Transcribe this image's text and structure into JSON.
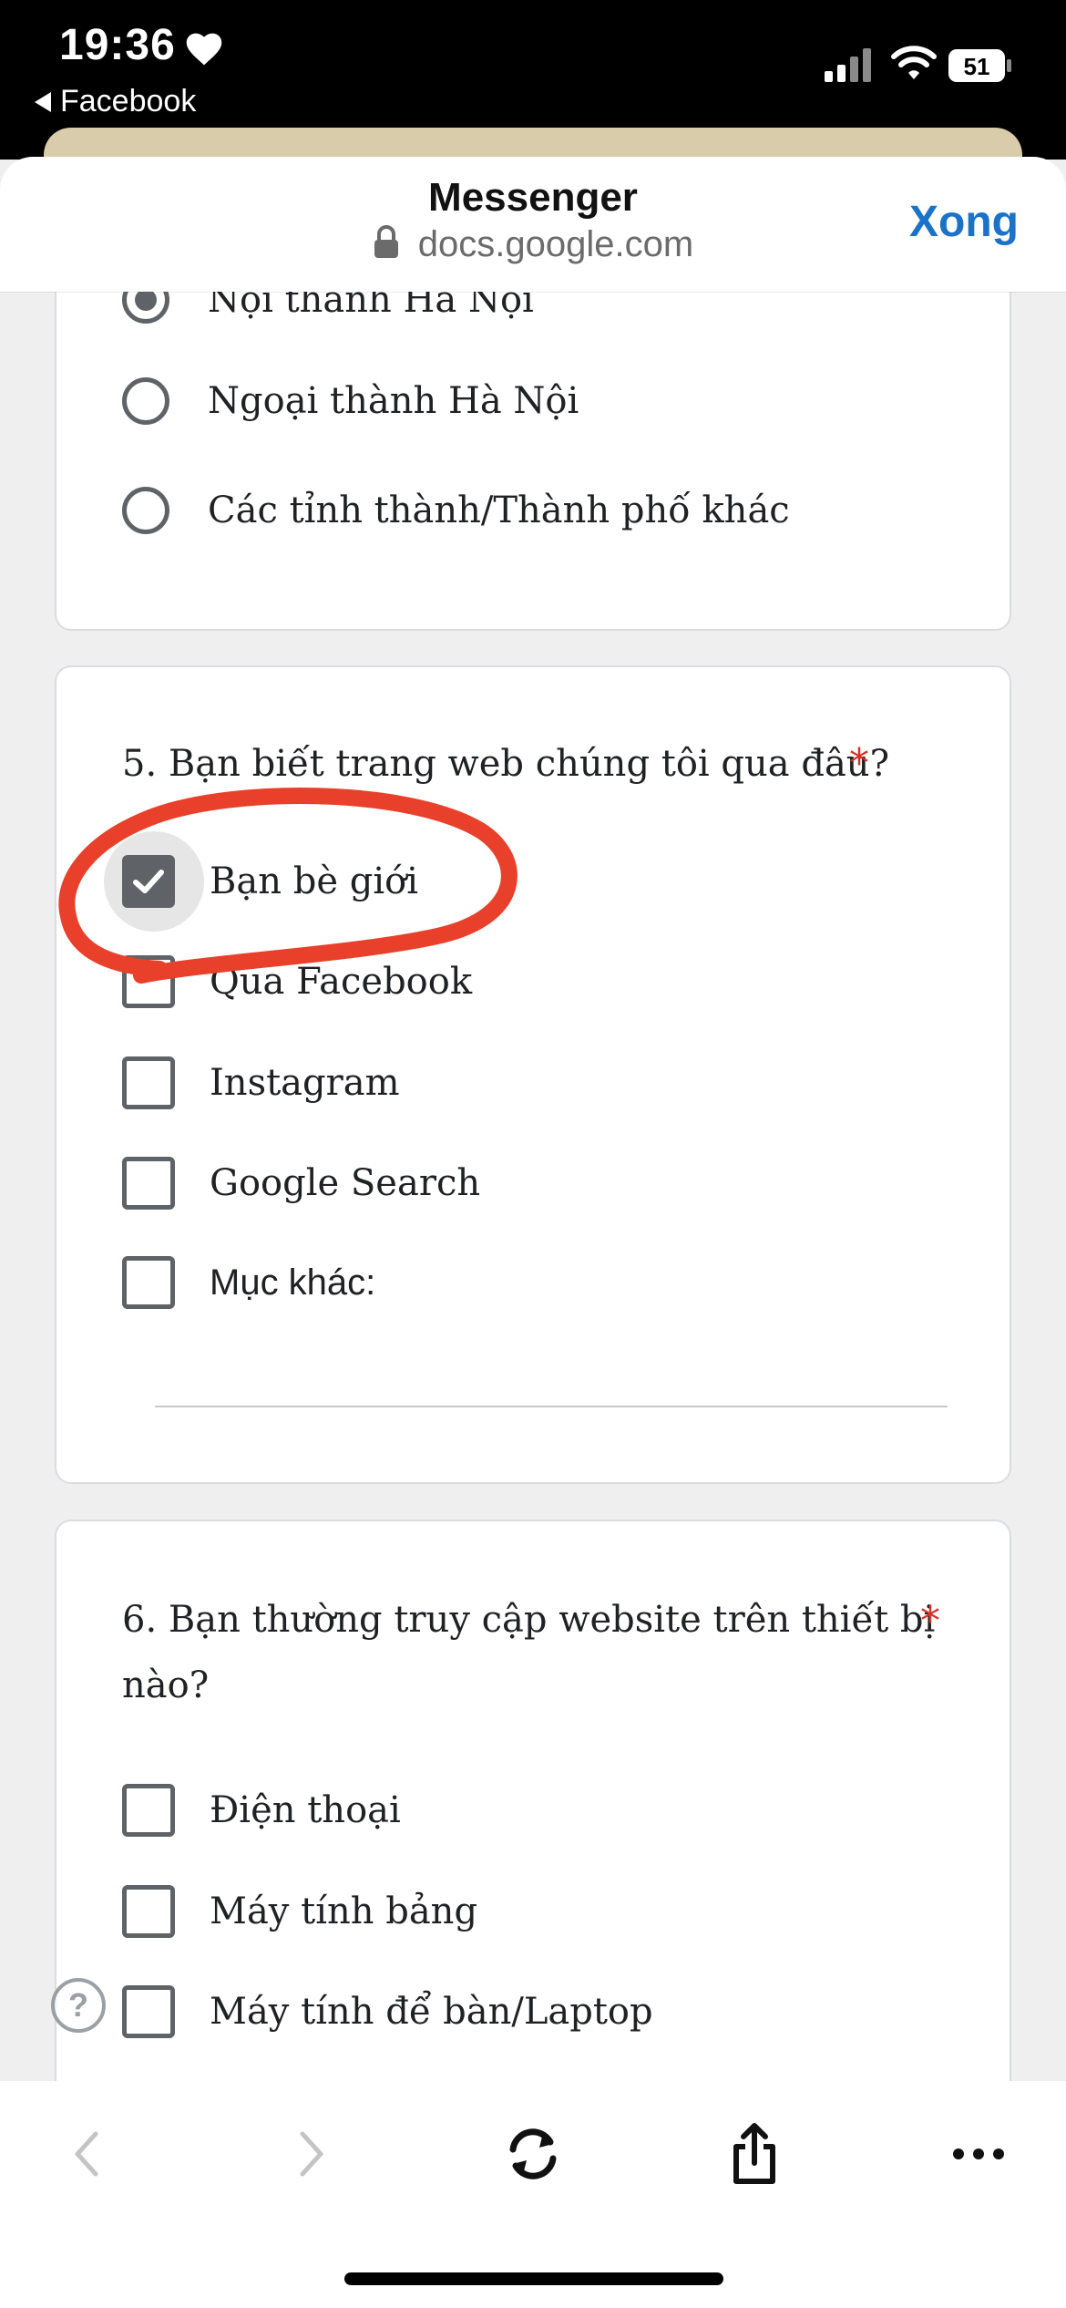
{
  "status_bar": {
    "time": "19:36",
    "back_app": "Facebook",
    "battery": "51",
    "icons": [
      "heart-icon",
      "cellular-signal-icon",
      "wifi-icon",
      "battery-icon"
    ]
  },
  "browser": {
    "title": "Messenger",
    "url": "docs.google.com",
    "done_label": "Xong"
  },
  "form": {
    "q4": {
      "options": [
        {
          "label": "Nội thành Hà Nội",
          "selected": true
        },
        {
          "label": "Ngoại thành Hà Nội",
          "selected": false
        },
        {
          "label": "Các tỉnh thành/Thành phố khác",
          "selected": false
        }
      ]
    },
    "q5": {
      "title": "5. Bạn biết trang web chúng tôi qua đâu?",
      "required_mark": "*",
      "options": [
        {
          "label": "Bạn bè giới",
          "checked": true
        },
        {
          "label": "Qua Facebook",
          "checked": false
        },
        {
          "label": "Instagram",
          "checked": false
        },
        {
          "label": "Google Search",
          "checked": false
        },
        {
          "label": "Mục khác:",
          "checked": false
        }
      ]
    },
    "q6": {
      "title_line1": "6.  Bạn thường truy cập website trên thiết bị",
      "title_line2": "nào?",
      "required_mark": "*",
      "options": [
        {
          "label": "Điện thoại",
          "checked": false
        },
        {
          "label": "Máy tính bảng",
          "checked": false
        },
        {
          "label": "Máy tính để bàn/Laptop",
          "checked": false
        }
      ]
    }
  },
  "help": {
    "label": "?"
  },
  "annotation_color": "#e8402a",
  "accent_color": "#1a73c9",
  "toolbar_icons": [
    "back-arrow-icon",
    "forward-arrow-icon",
    "refresh-icon",
    "share-icon",
    "more-icon"
  ]
}
